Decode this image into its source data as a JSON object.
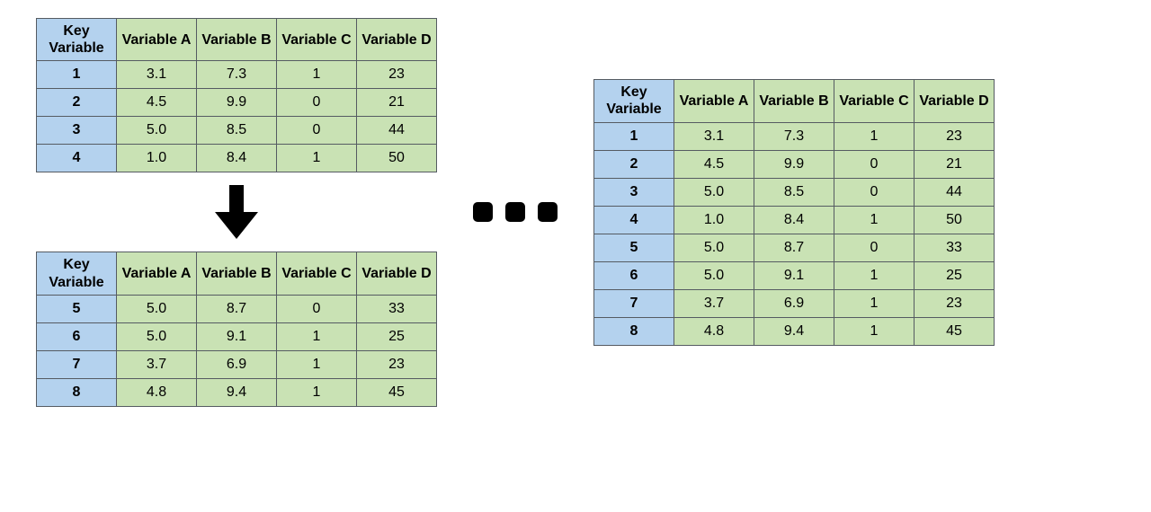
{
  "columns": {
    "key": "Key Variable",
    "a": "Variable A",
    "b": "Variable B",
    "c": "Variable C",
    "d": "Variable D"
  },
  "chart_data": [
    {
      "type": "table",
      "name": "top-table",
      "columns": [
        "Key Variable",
        "Variable A",
        "Variable B",
        "Variable C",
        "Variable D"
      ],
      "rows": [
        {
          "key": "1",
          "a": "3.1",
          "b": "7.3",
          "c": "1",
          "d": "23"
        },
        {
          "key": "2",
          "a": "4.5",
          "b": "9.9",
          "c": "0",
          "d": "21"
        },
        {
          "key": "3",
          "a": "5.0",
          "b": "8.5",
          "c": "0",
          "d": "44"
        },
        {
          "key": "4",
          "a": "1.0",
          "b": "8.4",
          "c": "1",
          "d": "50"
        }
      ]
    },
    {
      "type": "table",
      "name": "bottom-table",
      "columns": [
        "Key Variable",
        "Variable A",
        "Variable B",
        "Variable C",
        "Variable D"
      ],
      "rows": [
        {
          "key": "5",
          "a": "5.0",
          "b": "8.7",
          "c": "0",
          "d": "33"
        },
        {
          "key": "6",
          "a": "5.0",
          "b": "9.1",
          "c": "1",
          "d": "25"
        },
        {
          "key": "7",
          "a": "3.7",
          "b": "6.9",
          "c": "1",
          "d": "23"
        },
        {
          "key": "8",
          "a": "4.8",
          "b": "9.4",
          "c": "1",
          "d": "45"
        }
      ]
    },
    {
      "type": "table",
      "name": "merged-table",
      "columns": [
        "Key Variable",
        "Variable A",
        "Variable B",
        "Variable C",
        "Variable D"
      ],
      "rows": [
        {
          "key": "1",
          "a": "3.1",
          "b": "7.3",
          "c": "1",
          "d": "23"
        },
        {
          "key": "2",
          "a": "4.5",
          "b": "9.9",
          "c": "0",
          "d": "21"
        },
        {
          "key": "3",
          "a": "5.0",
          "b": "8.5",
          "c": "0",
          "d": "44"
        },
        {
          "key": "4",
          "a": "1.0",
          "b": "8.4",
          "c": "1",
          "d": "50"
        },
        {
          "key": "5",
          "a": "5.0",
          "b": "8.7",
          "c": "0",
          "d": "33"
        },
        {
          "key": "6",
          "a": "5.0",
          "b": "9.1",
          "c": "1",
          "d": "25"
        },
        {
          "key": "7",
          "a": "3.7",
          "b": "6.9",
          "c": "1",
          "d": "23"
        },
        {
          "key": "8",
          "a": "4.8",
          "b": "9.4",
          "c": "1",
          "d": "45"
        }
      ]
    }
  ]
}
